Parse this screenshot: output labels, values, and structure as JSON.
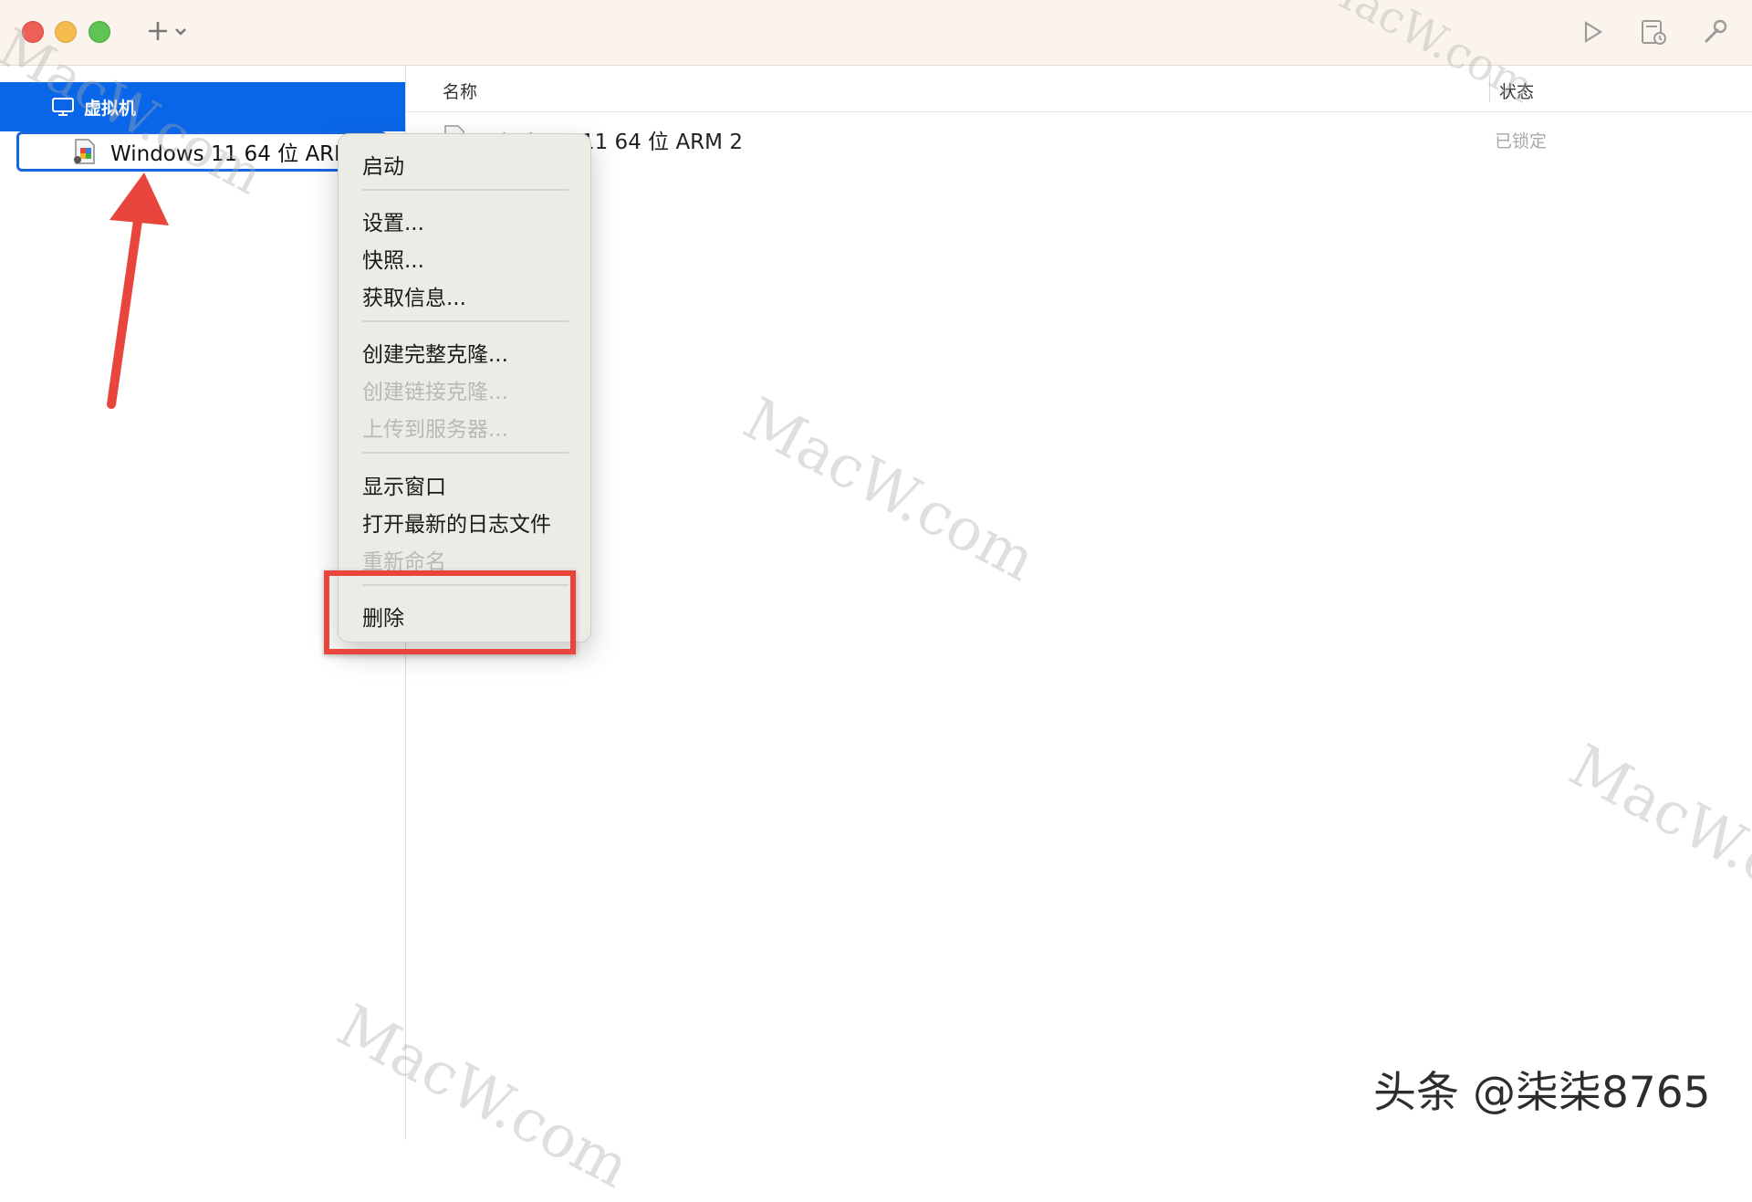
{
  "sidebar": {
    "group_label": "虚拟机",
    "vm_item_label": "Windows 11 64 位 ARM 2"
  },
  "list": {
    "columns": {
      "name": "名称",
      "status": "状态"
    },
    "rows": [
      {
        "name": "Windows 11 64 位 ARM 2",
        "status": "已锁定"
      }
    ]
  },
  "context_menu": {
    "start": "启动",
    "settings": "设置...",
    "snapshots": "快照...",
    "get_info": "获取信息...",
    "full_clone": "创建完整克隆...",
    "linked_clone": "创建链接克隆...",
    "upload": "上传到服务器...",
    "show_window": "显示窗口",
    "open_log": "打开最新的日志文件",
    "rename": "重新命名",
    "delete": "删除"
  },
  "watermark": {
    "text": "MacW.com"
  },
  "credit": {
    "text": "头条 @柒柒8765"
  },
  "colors": {
    "titlebar": "#fbf4ed",
    "selection": "#0a66e8",
    "annotation_red": "#e8453c",
    "menu_bg": "#ecebe6"
  }
}
